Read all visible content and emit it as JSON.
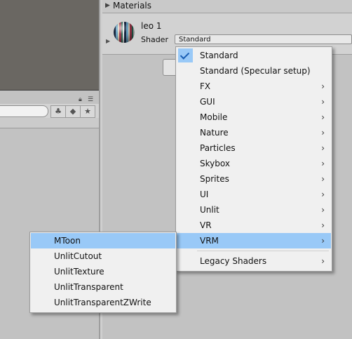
{
  "inspector": {
    "section_title": "Materials",
    "object_name": "leo 1",
    "shader_label": "Shader",
    "shader_value": "Standard"
  },
  "left_panel": {
    "lock_icon": "lock-icon",
    "menu_icon": "panel-menu-icon",
    "toolbar_icons": [
      "filter-by-type-icon",
      "filter-by-label-icon",
      "favorite-star-icon"
    ]
  },
  "shader_menu": {
    "items": [
      {
        "label": "Standard",
        "checked": true,
        "submenu": false
      },
      {
        "label": "Standard (Specular setup)",
        "checked": false,
        "submenu": false
      },
      {
        "label": "FX",
        "submenu": true
      },
      {
        "label": "GUI",
        "submenu": true
      },
      {
        "label": "Mobile",
        "submenu": true
      },
      {
        "label": "Nature",
        "submenu": true
      },
      {
        "label": "Particles",
        "submenu": true
      },
      {
        "label": "Skybox",
        "submenu": true
      },
      {
        "label": "Sprites",
        "submenu": true
      },
      {
        "label": "UI",
        "submenu": true
      },
      {
        "label": "Unlit",
        "submenu": true
      },
      {
        "label": "VR",
        "submenu": true
      },
      {
        "label": "VRM",
        "submenu": true,
        "highlighted": true
      },
      {
        "label": "Legacy Shaders",
        "submenu": true
      }
    ],
    "arrow_glyph": "›"
  },
  "vrm_submenu": {
    "items": [
      {
        "label": "MToon",
        "highlighted": true
      },
      {
        "label": "UnlitCutout"
      },
      {
        "label": "UnlitTexture"
      },
      {
        "label": "UnlitTransparent"
      },
      {
        "label": "UnlitTransparentZWrite"
      }
    ]
  },
  "colors": {
    "highlight": "#99c9f7",
    "menu_bg": "#f0f0f0",
    "editor_bg": "#c2c2c2"
  }
}
